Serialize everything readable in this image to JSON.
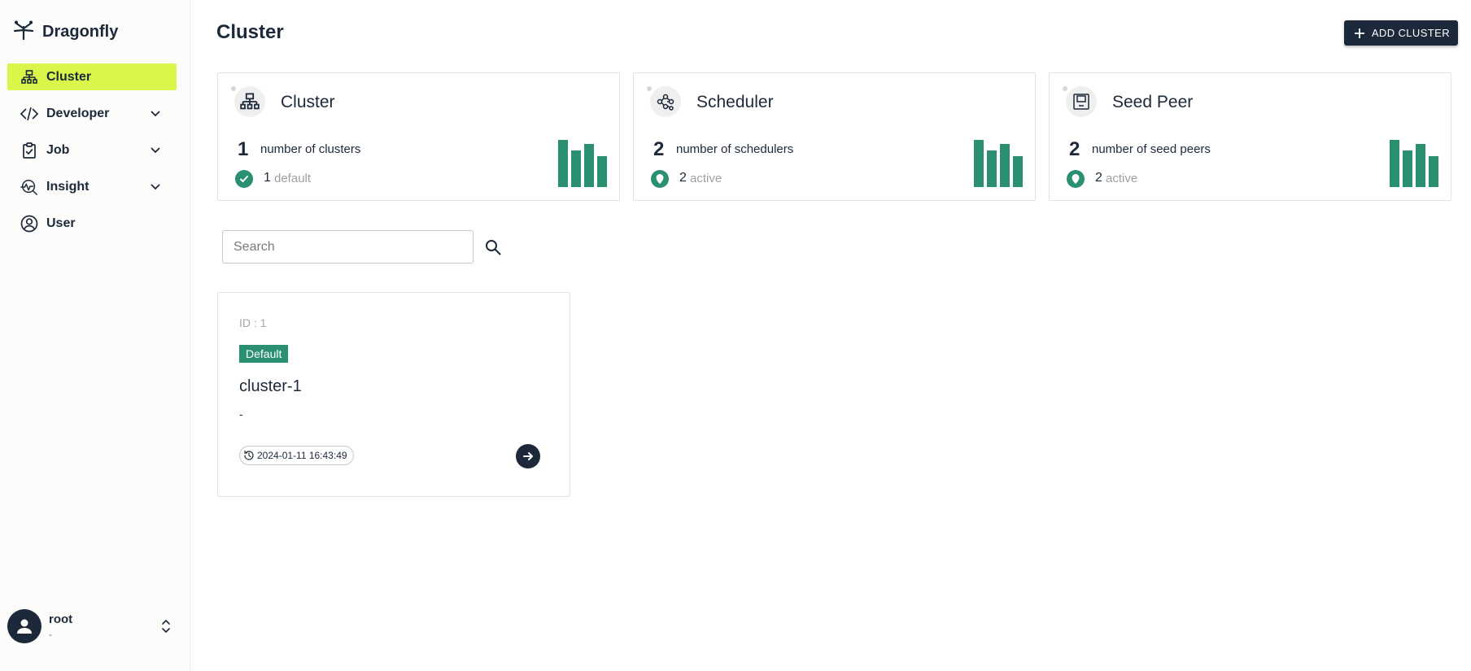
{
  "brand": {
    "name": "Dragonfly"
  },
  "sidebar": {
    "items": [
      {
        "label": "Cluster",
        "icon": "cluster-icon",
        "active": true,
        "expandable": false
      },
      {
        "label": "Developer",
        "icon": "code-icon",
        "active": false,
        "expandable": true
      },
      {
        "label": "Job",
        "icon": "clipboard-check-icon",
        "active": false,
        "expandable": true
      },
      {
        "label": "Insight",
        "icon": "insight-chart-icon",
        "active": false,
        "expandable": true
      },
      {
        "label": "User",
        "icon": "user-circle-icon",
        "active": false,
        "expandable": false
      }
    ]
  },
  "user": {
    "name": "root",
    "subtitle": "-"
  },
  "header": {
    "title": "Cluster",
    "add_button_label": "ADD CLUSTER"
  },
  "stats": [
    {
      "title": "Cluster",
      "count": "1",
      "description": "number of clusters",
      "sub_count": "1",
      "sub_label": "default",
      "icon": "cluster-icon",
      "status_icon": "check-icon",
      "bars": [
        1.0,
        0.78,
        0.92,
        0.65
      ]
    },
    {
      "title": "Scheduler",
      "count": "2",
      "description": "number of schedulers",
      "sub_count": "2",
      "sub_label": "active",
      "icon": "scheduler-icon",
      "status_icon": "pin-icon",
      "bars": [
        1.0,
        0.78,
        0.92,
        0.65
      ]
    },
    {
      "title": "Seed Peer",
      "count": "2",
      "description": "number of seed peers",
      "sub_count": "2",
      "sub_label": "active",
      "icon": "seed-peer-icon",
      "status_icon": "pin-icon",
      "bars": [
        1.0,
        0.78,
        0.92,
        0.65
      ]
    }
  ],
  "search": {
    "placeholder": "Search",
    "value": ""
  },
  "cluster_card": {
    "id_label": "ID : 1",
    "badge": "Default",
    "name": "cluster-1",
    "description": "-",
    "created_at": "2024-01-11 16:43:49"
  },
  "colors": {
    "accent": "#daf64b",
    "primary": "#1c293a",
    "green": "#2b8f71"
  }
}
